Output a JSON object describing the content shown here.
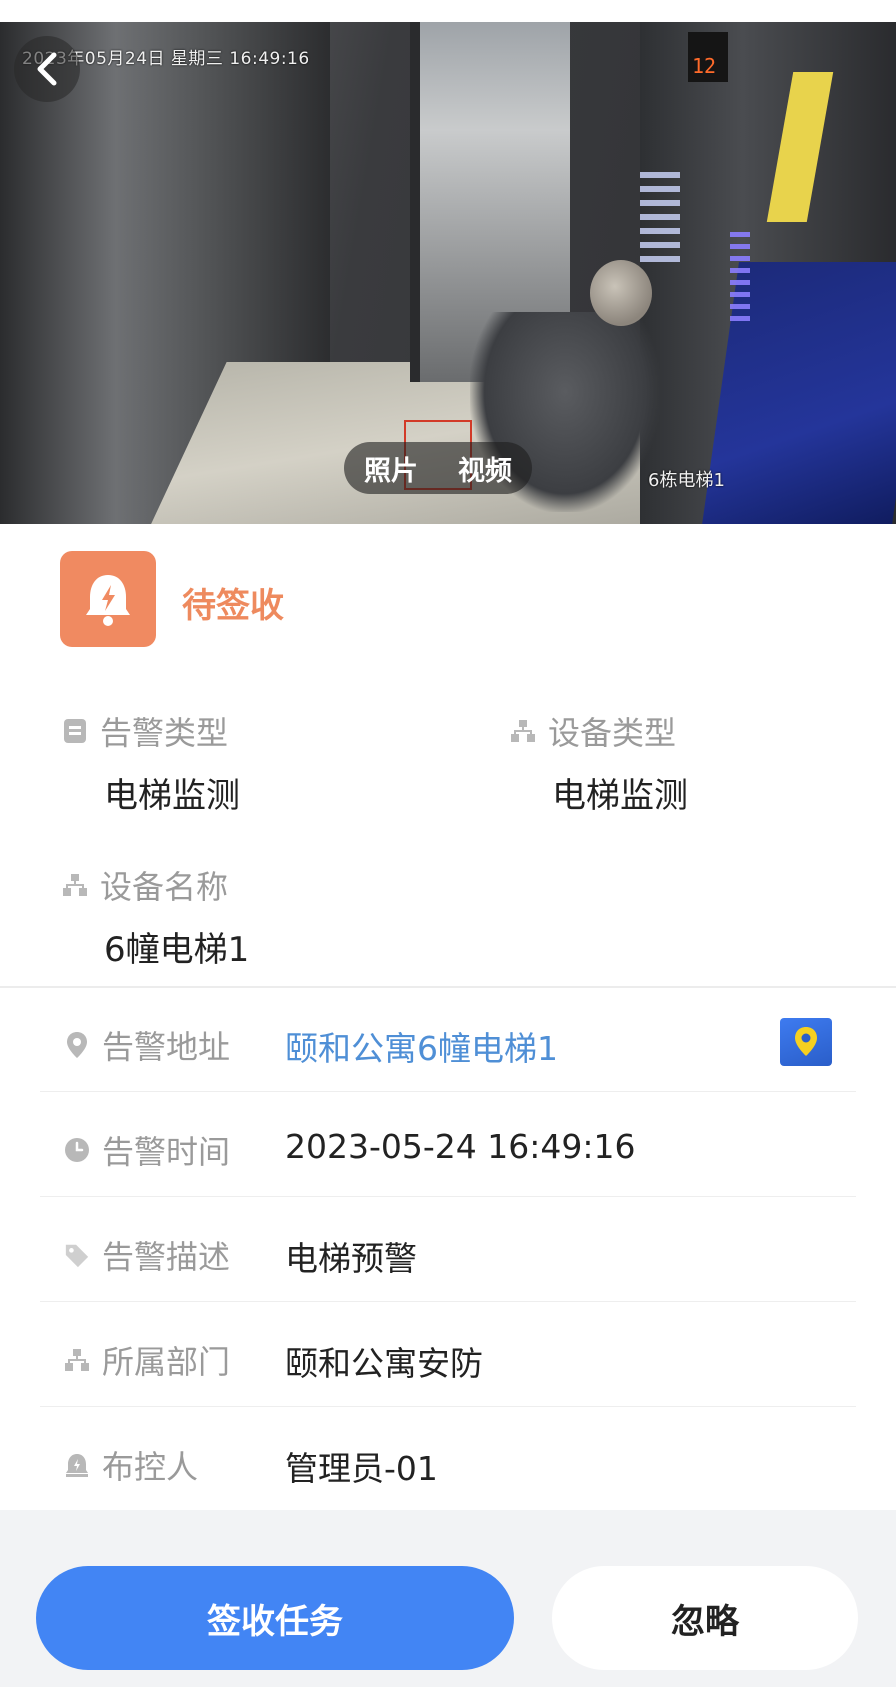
{
  "camera": {
    "timestamp_overlay": "2023年05月24日 星期三 16:49:16",
    "camera_label": "6栋电梯1",
    "floor_display": "12",
    "tabs": [
      "照片",
      "视频"
    ]
  },
  "status": {
    "label": "待签收",
    "color": "#ee8a5e"
  },
  "info": {
    "alarm_type": {
      "label": "告警类型",
      "value": "电梯监测"
    },
    "device_type": {
      "label": "设备类型",
      "value": "电梯监测"
    },
    "device_name": {
      "label": "设备名称",
      "value": "6幢电梯1"
    }
  },
  "details": [
    {
      "label": "告警地址",
      "value": "颐和公寓6幢电梯1"
    },
    {
      "label": "告警时间",
      "value": "2023-05-24 16:49:16"
    },
    {
      "label": "告警描述",
      "value": "电梯预警"
    },
    {
      "label": "所属部门",
      "value": "颐和公寓安防"
    },
    {
      "label": "布控人",
      "value": "管理员-01"
    }
  ],
  "actions": {
    "accept": "签收任务",
    "ignore": "忽略"
  },
  "colors": {
    "primary": "#4285f4",
    "link": "#4f8fd6",
    "status": "#f08a61"
  }
}
